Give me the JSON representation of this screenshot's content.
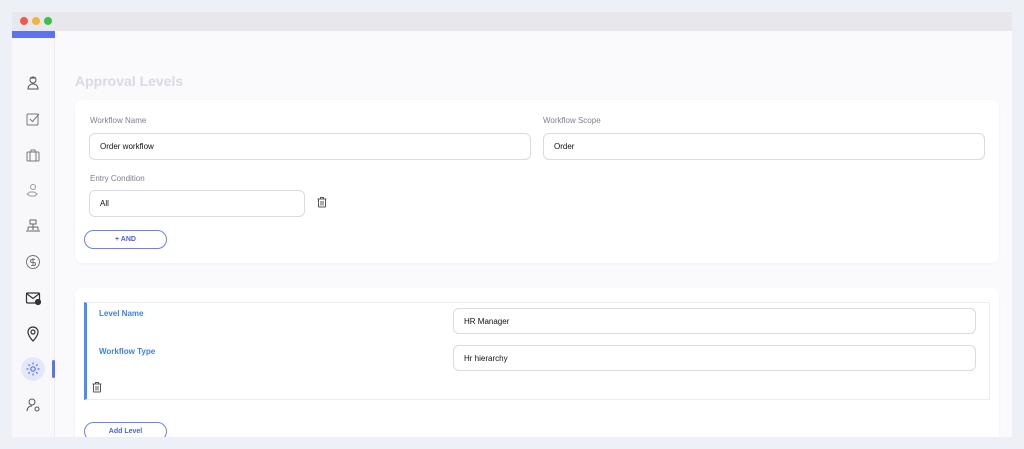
{
  "window": {
    "controls": [
      "close",
      "minimize",
      "maximize"
    ]
  },
  "sidebar": {
    "accent_color": "#5b73ee",
    "items": [
      {
        "icon": "user-profile-icon",
        "active": false
      },
      {
        "icon": "checkbox-icon",
        "active": false
      },
      {
        "icon": "briefcase-icon",
        "active": false
      },
      {
        "icon": "hand-coin-icon",
        "active": false
      },
      {
        "icon": "org-chart-icon",
        "active": false
      },
      {
        "icon": "dollar-icon",
        "active": false
      },
      {
        "icon": "mail-icon",
        "active": false
      },
      {
        "icon": "location-pin-icon",
        "active": false
      },
      {
        "icon": "gear-icon",
        "active": true
      },
      {
        "icon": "user-settings-icon",
        "active": false
      }
    ]
  },
  "page": {
    "title": "Approval Levels"
  },
  "workflow": {
    "name_label": "Workflow Name",
    "name_value": "Order workflow",
    "scope_label": "Workflow Scope",
    "scope_value": "Order",
    "entry_label": "Entry Condition",
    "entry_value": "All",
    "and_button": "+ AND"
  },
  "level": {
    "name_label": "Level Name",
    "name_value": "HR Manager",
    "type_label": "Workflow Type",
    "type_value": "Hr hierarchy",
    "add_button": "Add Level",
    "accent_color": "#4d8cf0"
  }
}
